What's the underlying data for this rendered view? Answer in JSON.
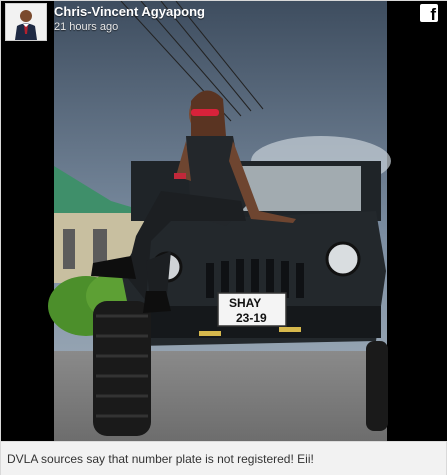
{
  "post": {
    "author_name": "Chris-Vincent Agyapong",
    "timestamp": "21 hours ago",
    "caption": "DVLA sources say that number plate is not registered! Eii!"
  },
  "icons": {
    "avatar": "profile-photo",
    "brand": "facebook-icon"
  },
  "plate": {
    "line1": "SHAY",
    "line2": "23-19"
  },
  "colors": {
    "frame_background": "#000000",
    "caption_background": "#f2f2f2",
    "header_text": "#ffffff",
    "caption_text": "#333333"
  }
}
